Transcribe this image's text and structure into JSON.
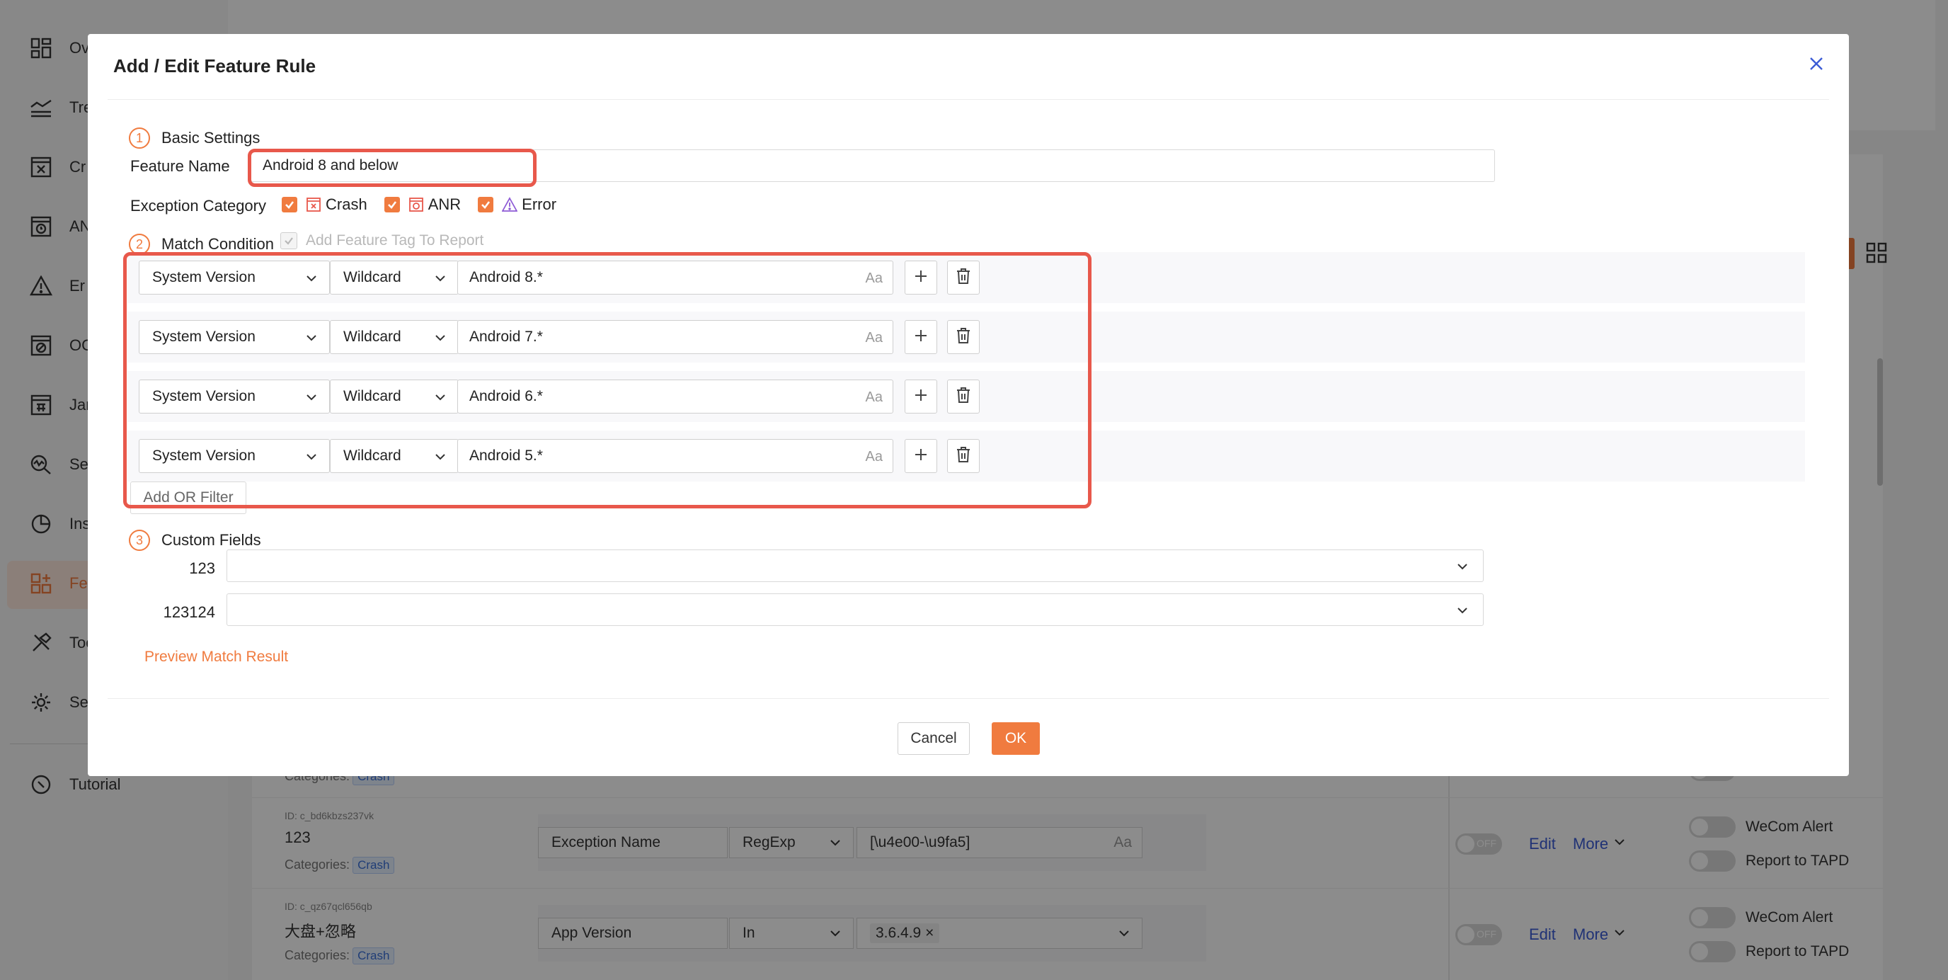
{
  "sidebar": {
    "items": [
      {
        "label": "Ov",
        "icon": "dashboard-grid-icon"
      },
      {
        "label": "Tre",
        "icon": "trend-lines-icon"
      },
      {
        "label": "Cr",
        "icon": "crash-window-icon"
      },
      {
        "label": "AN",
        "icon": "anr-window-icon"
      },
      {
        "label": "Er",
        "icon": "error-warning-icon"
      },
      {
        "label": "OC",
        "icon": "oom-window-icon"
      },
      {
        "label": "Jan",
        "icon": "jank-window-icon"
      },
      {
        "label": "Se",
        "icon": "search-chart-icon"
      },
      {
        "label": "Ins",
        "icon": "pie-chart-icon"
      },
      {
        "label": "Fe",
        "icon": "feature-grid-icon"
      },
      {
        "label": "Too",
        "icon": "tools-icon"
      },
      {
        "label": "Se",
        "icon": "settings-gear-icon"
      }
    ],
    "tutorial_label": "Tutorial"
  },
  "background": {
    "rows": [
      {
        "id": "ID: c_bd6kbzs237vk",
        "name": "123",
        "categories_label": "Categories:",
        "category": "Crash",
        "field": "Exception Name",
        "op": "RegExp",
        "value": "[\\u4e00-\\u9fa5]",
        "toggle": "OFF",
        "edit": "Edit",
        "more": "More",
        "alert": "WeCom Alert",
        "report": "Report to TAPD"
      },
      {
        "id": "ID: c_qz67qcl656qb",
        "name": "大盘+忽略",
        "categories_label": "Categories:",
        "category": "Crash",
        "field": "App Version",
        "op": "In",
        "value": "3.6.4.9",
        "toggle": "OFF",
        "edit": "Edit",
        "more": "More",
        "alert": "WeCom Alert",
        "report": "Report to TAPD"
      }
    ],
    "partial_categories_label": "Categories:",
    "partial_category": "Crash"
  },
  "modal": {
    "title": "Add / Edit Feature Rule",
    "step1": {
      "num": "1",
      "label": "Basic Settings"
    },
    "feature_name_label": "Feature Name",
    "feature_name_value": "Android 8 and below",
    "exception_category_label": "Exception Category",
    "categories": [
      {
        "label": "Crash",
        "icon": "crash-icon",
        "color": "#e8584b"
      },
      {
        "label": "ANR",
        "icon": "anr-icon",
        "color": "#e8584b"
      },
      {
        "label": "Error",
        "icon": "error-warning-icon",
        "color": "#8e5bd6"
      }
    ],
    "step2": {
      "num": "2",
      "label": "Match Condition"
    },
    "add_tag_label": "Add Feature Tag To Report",
    "conditions": [
      {
        "field": "System Version",
        "operator": "Wildcard",
        "value": "Android 8.*"
      },
      {
        "field": "System Version",
        "operator": "Wildcard",
        "value": "Android 7.*"
      },
      {
        "field": "System Version",
        "operator": "Wildcard",
        "value": "Android 6.*"
      },
      {
        "field": "System Version",
        "operator": "Wildcard",
        "value": "Android 5.*"
      }
    ],
    "case_toggle_label": "Aa",
    "add_or_filter_label": "Add OR Filter",
    "step3": {
      "num": "3",
      "label": "Custom Fields"
    },
    "custom_fields": [
      {
        "label": "123",
        "value": ""
      },
      {
        "label": "123124",
        "value": ""
      }
    ],
    "preview_label": "Preview Match Result",
    "cancel_label": "Cancel",
    "ok_label": "OK",
    "accent_color": "#f07b3f",
    "highlight_color": "#e8584b"
  }
}
